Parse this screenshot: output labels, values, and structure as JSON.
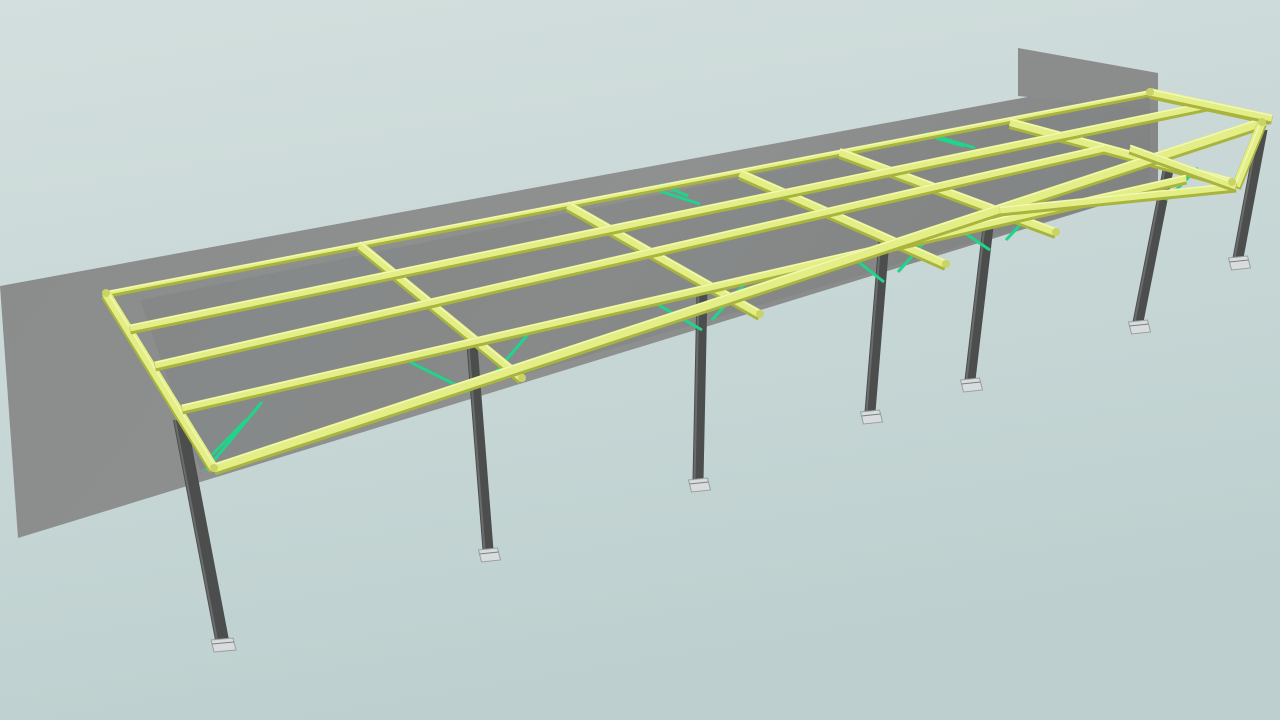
{
  "scene": {
    "background_top": "#d2dedd",
    "background_bottom": "#bccfcf",
    "wall_fill": "#8c8e8e",
    "wall_shade": "#7f8181",
    "beam_color": "#e4ee86",
    "beam_shadow": "#a8b43e",
    "beam_highlight": "#f4f9b8",
    "column_color": "#4c4e4e",
    "column_highlight": "#6a6c6c",
    "base_plate_color": "#d8dcdc",
    "brace_color": "#20d48c",
    "ledger_color": "#1f8fa8"
  }
}
